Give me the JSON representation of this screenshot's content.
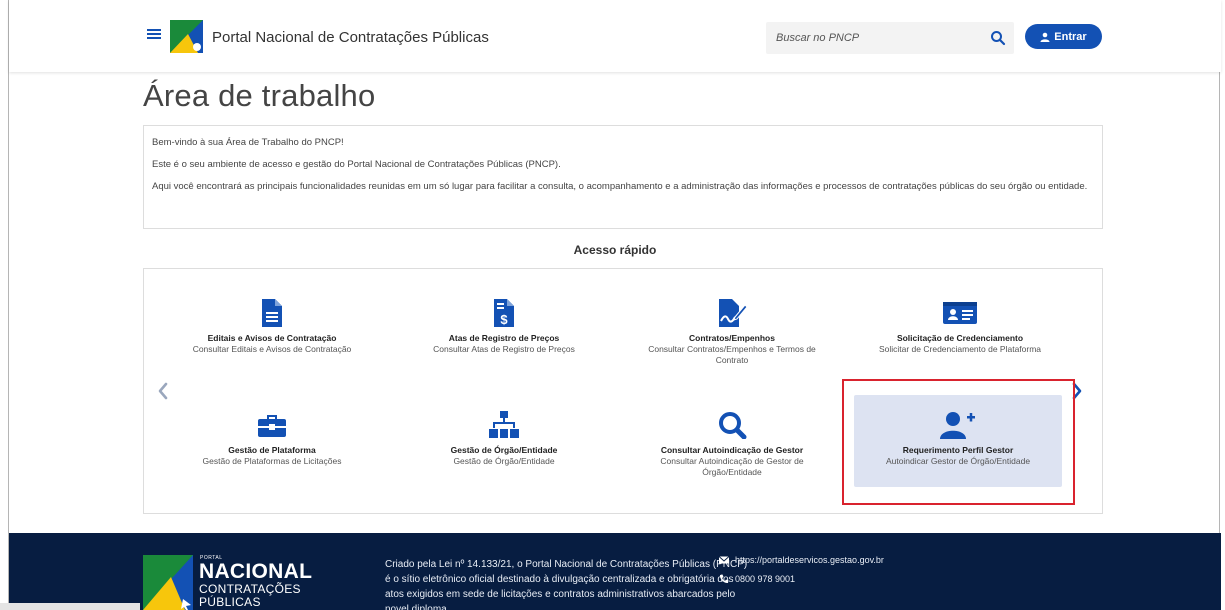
{
  "header": {
    "portal_title": "Portal Nacional de Contratações Públicas",
    "search_placeholder": "Buscar no PNCP",
    "login_label": "Entrar"
  },
  "page": {
    "title": "Área de trabalho"
  },
  "welcome": {
    "line1": "Bem-vindo à sua Área de Trabalho do PNCP!",
    "line2": "Este é o seu ambiente de acesso e gestão do Portal Nacional de Contratações Públicas (PNCP).",
    "line3": "Aqui você encontrará as principais funcionalidades reunidas em um só lugar para facilitar a consulta, o acompanhamento e a administração das informações e processos de contratações públicas do seu órgão ou entidade."
  },
  "quick_access": {
    "title": "Acesso rápido",
    "cards": [
      {
        "title": "Editais e Avisos de Contratação",
        "subtitle": "Consultar Editais e Avisos de Contratação",
        "icon": "document-icon"
      },
      {
        "title": "Atas de Registro de Preços",
        "subtitle": "Consultar Atas de Registro de Preços",
        "icon": "price-document-icon"
      },
      {
        "title": "Contratos/Empenhos",
        "subtitle": "Consultar Contratos/Empenhos e Termos de Contrato",
        "icon": "signature-icon"
      },
      {
        "title": "Solicitação de Credenciamento",
        "subtitle": "Solicitar de Credenciamento de Plataforma",
        "icon": "id-card-icon"
      },
      {
        "title": "Gestão de Plataforma",
        "subtitle": "Gestão de Plataformas de Licitações",
        "icon": "briefcase-icon"
      },
      {
        "title": "Gestão de Órgão/Entidade",
        "subtitle": "Gestão de Órgão/Entidade",
        "icon": "org-chart-icon"
      },
      {
        "title": "Consultar Autoindicação de Gestor",
        "subtitle": "Consultar Autoindicação de Gestor de Órgão/Entidade",
        "icon": "search-icon"
      },
      {
        "title": "Requerimento Perfil Gestor",
        "subtitle": "Autoindicar Gestor de Órgão/Entidade",
        "icon": "user-plus-icon"
      }
    ]
  },
  "footer": {
    "logo_portal": "PORTAL",
    "logo_nacional": "NACIONAL",
    "logo_contratacoes": "CONTRATAÇÕES",
    "logo_publicas": "PÚBLICAS",
    "description": "Criado pela Lei nº 14.133/21, o Portal Nacional de Contratações Públicas (PNCP) é o sítio eletrônico oficial destinado à divulgação centralizada e obrigatória dos atos exigidos em sede de licitações e contratos administrativos abarcados pelo novel diploma.",
    "email": "https://portaldeservicos.gestao.gov.br",
    "phone": "0800 978 9001"
  },
  "colors": {
    "primary": "#1351b4",
    "footer_bg": "#071d41",
    "highlight_border": "#d9232e",
    "active_card_bg": "#dde3f2"
  }
}
